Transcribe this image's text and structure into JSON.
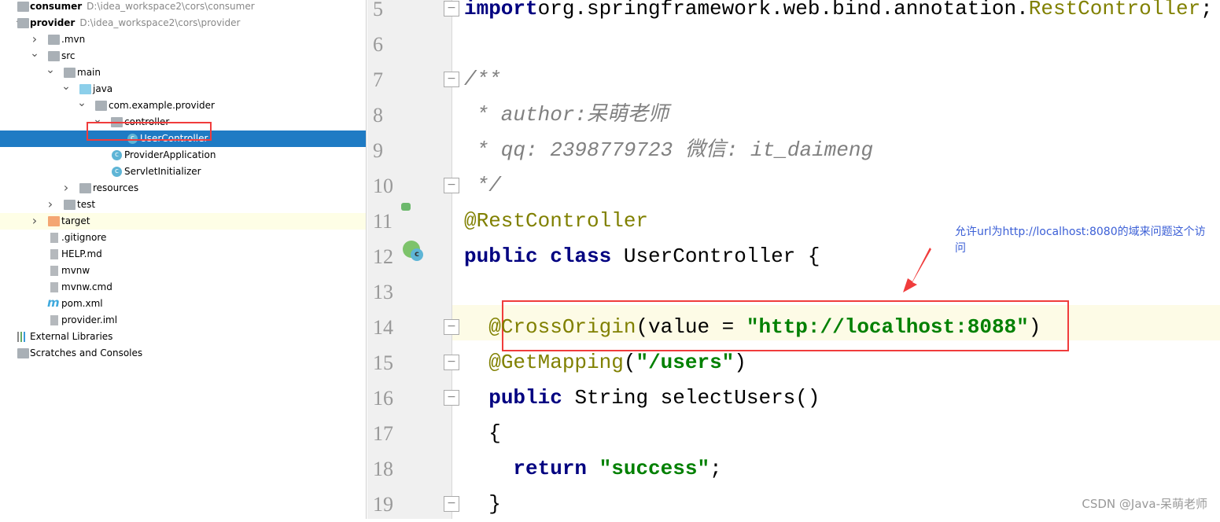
{
  "tree": {
    "items": [
      {
        "label": "consumer",
        "path": "D:\\idea_workspace2\\cors\\consumer",
        "icon": "module-icon",
        "arrow": "right",
        "level": 0,
        "bold": true
      },
      {
        "label": "provider",
        "path": "D:\\idea_workspace2\\cors\\provider",
        "icon": "module-icon",
        "arrow": "down",
        "level": 0,
        "bold": true
      },
      {
        "label": ".mvn",
        "icon": "folder-icon",
        "arrow": "right",
        "level": 1
      },
      {
        "label": "src",
        "icon": "folder-icon",
        "arrow": "down",
        "level": 1
      },
      {
        "label": "main",
        "icon": "folder-icon",
        "arrow": "down",
        "level": 2
      },
      {
        "label": "java",
        "icon": "source-folder-icon",
        "arrow": "down",
        "level": 3
      },
      {
        "label": "com.example.provider",
        "icon": "package-icon",
        "arrow": "down",
        "level": 4
      },
      {
        "label": "controller",
        "icon": "package-icon",
        "arrow": "down",
        "level": 5
      },
      {
        "label": "UserController",
        "icon": "class-icon",
        "level": 6,
        "selected": true
      },
      {
        "label": "ProviderApplication",
        "icon": "spring-boot-class-icon",
        "level": 5
      },
      {
        "label": "ServletInitializer",
        "icon": "class-icon",
        "level": 5
      },
      {
        "label": "resources",
        "icon": "resources-folder-icon",
        "arrow": "right",
        "level": 3
      },
      {
        "label": "test",
        "icon": "folder-icon",
        "arrow": "right",
        "level": 2
      },
      {
        "label": "target",
        "icon": "excluded-folder-icon",
        "arrow": "right",
        "level": 1,
        "highlight": true
      },
      {
        "label": ".gitignore",
        "icon": "text-file-icon",
        "level": 1
      },
      {
        "label": "HELP.md",
        "icon": "markdown-file-icon",
        "level": 1
      },
      {
        "label": "mvnw",
        "icon": "text-file-icon",
        "level": 1
      },
      {
        "label": "mvnw.cmd",
        "icon": "text-file-icon",
        "level": 1
      },
      {
        "label": "pom.xml",
        "icon": "maven-icon",
        "level": 1
      },
      {
        "label": "provider.iml",
        "icon": "iml-file-icon",
        "level": 1
      },
      {
        "label": "External Libraries",
        "icon": "libraries-icon",
        "arrow": "right",
        "level": 0
      },
      {
        "label": "Scratches and Consoles",
        "icon": "scratches-icon",
        "level": 0
      }
    ]
  },
  "editor": {
    "current_line": 14,
    "lines": [
      {
        "n": "5",
        "tokens": [
          [
            "kw",
            "import"
          ],
          [
            "",
            "org.springframework.web.bind.annotation."
          ],
          [
            "ann",
            "RestController"
          ],
          [
            "",
            ";"
          ]
        ]
      },
      {
        "n": "6",
        "tokens": []
      },
      {
        "n": "7",
        "tokens": [
          [
            "cmt",
            "/**"
          ]
        ]
      },
      {
        "n": "8",
        "tokens": [
          [
            "cmt",
            " * author:呆萌老师"
          ]
        ]
      },
      {
        "n": "9",
        "tokens": [
          [
            "cmt",
            " * qq: 2398779723 微信: it_daimeng"
          ]
        ]
      },
      {
        "n": "10",
        "tokens": [
          [
            "cmt",
            " */"
          ]
        ]
      },
      {
        "n": "11",
        "tokens": [
          [
            "ann",
            "@RestController"
          ]
        ]
      },
      {
        "n": "12",
        "tokens": [
          [
            "kw",
            "public class "
          ],
          [
            "",
            "UserController {"
          ]
        ]
      },
      {
        "n": "13",
        "tokens": []
      },
      {
        "n": "14",
        "tokens": [
          [
            "",
            "  "
          ],
          [
            "ann",
            "@CrossOrigin"
          ],
          [
            "",
            "(value = "
          ],
          [
            "str",
            "\"http://localhost:8088\""
          ],
          [
            "",
            ")"
          ]
        ]
      },
      {
        "n": "15",
        "tokens": [
          [
            "",
            "  "
          ],
          [
            "ann",
            "@GetMapping"
          ],
          [
            "",
            "("
          ],
          [
            "str",
            "\"/users\""
          ],
          [
            "",
            ")"
          ]
        ]
      },
      {
        "n": "16",
        "tokens": [
          [
            "",
            "  "
          ],
          [
            "kw",
            "public "
          ],
          [
            "",
            "String selectUsers()"
          ]
        ]
      },
      {
        "n": "17",
        "tokens": [
          [
            "",
            "  {"
          ]
        ]
      },
      {
        "n": "18",
        "tokens": [
          [
            "",
            "    "
          ],
          [
            "kw",
            "return "
          ],
          [
            "str",
            "\"success\""
          ],
          [
            "",
            ";"
          ]
        ]
      },
      {
        "n": "19",
        "tokens": [
          [
            "",
            "  }"
          ]
        ]
      }
    ],
    "folds": [
      5,
      7,
      10,
      14,
      15,
      16,
      19
    ]
  },
  "annotation": {
    "note": "允许url为http://localhost:8080的域来问题这个访问",
    "color": "#f03c3c"
  },
  "watermark": "CSDN @Java-呆萌老师"
}
